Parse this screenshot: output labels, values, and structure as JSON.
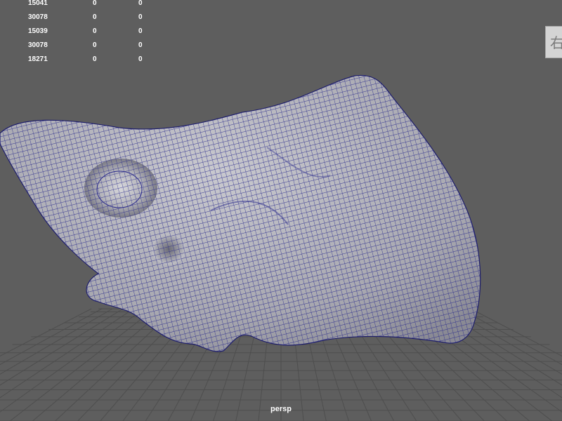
{
  "heads_up_display": {
    "rows": [
      {
        "values": [
          "15041",
          "0",
          "0"
        ]
      },
      {
        "values": [
          "30078",
          "0",
          "0"
        ]
      },
      {
        "values": [
          "15039",
          "0",
          "0"
        ]
      },
      {
        "values": [
          "30078",
          "0",
          "0"
        ]
      },
      {
        "values": [
          "18271",
          "0",
          "0"
        ]
      }
    ]
  },
  "camera": {
    "label": "persp"
  },
  "view_cube": {
    "face_label": "右"
  },
  "colors": {
    "background": "#5e5e5e",
    "grid_line": "#4e4e4e",
    "mesh_fill": "#b0b0b6",
    "wireframe": "#2a2a8c",
    "hud_text": "#ffffff"
  },
  "icons": {
    "view_cube": "view-cube-icon"
  }
}
